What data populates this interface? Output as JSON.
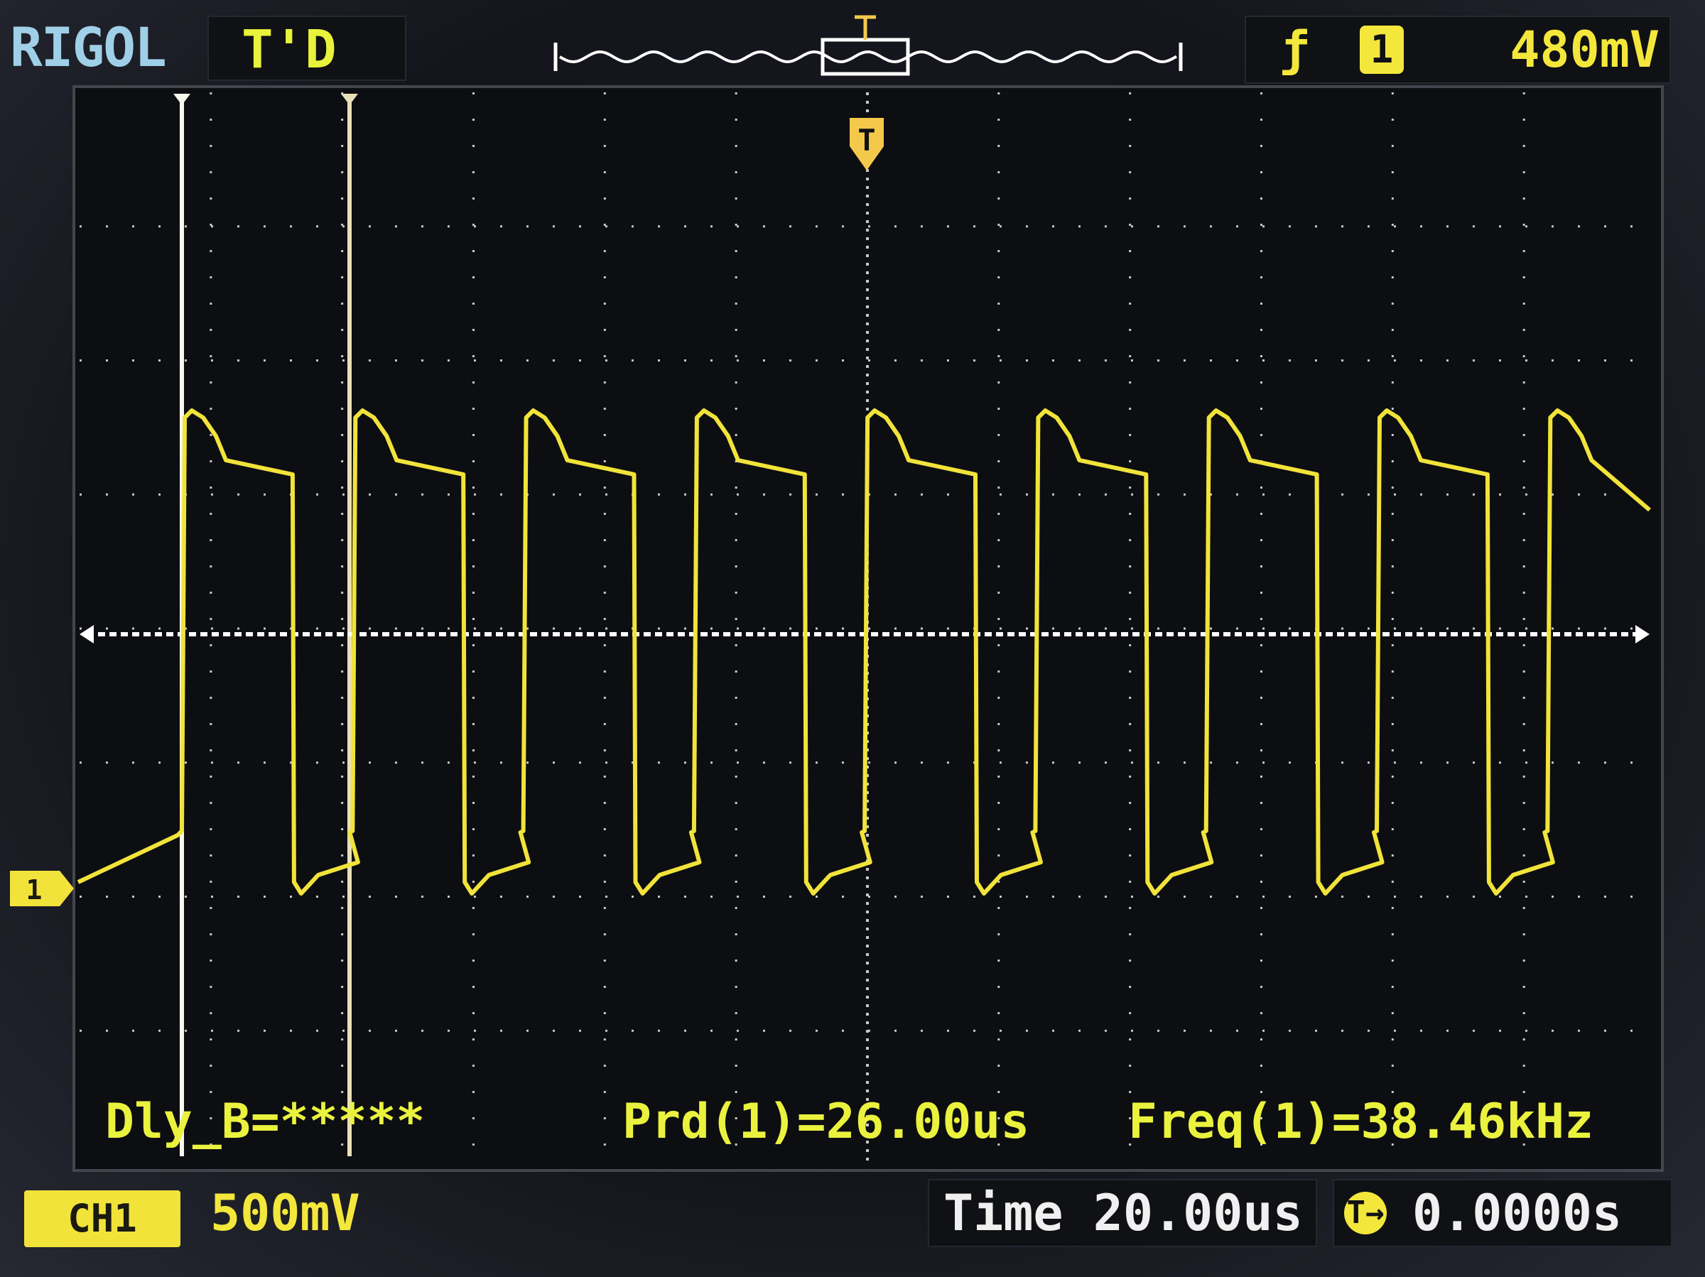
{
  "header": {
    "brand": "RIGOL",
    "run_status": "T'D",
    "trigger": {
      "edge_icon": "rising-edge-icon",
      "edge_glyph": "ƒ",
      "source": "1",
      "level": "480mV"
    }
  },
  "measurements": {
    "delay": "Dly_B=*****",
    "period": "Prd(1)=26.00us",
    "frequency": "Freq(1)=38.46kHz"
  },
  "footer": {
    "channel_badge": "CH1",
    "channel_scale": "500mV",
    "timebase": "Time 20.00us",
    "trigger_offset": "0.0000s",
    "trigger_offset_icon": "trigger-offset-icon",
    "trigger_offset_glyph": "T→"
  },
  "channel_marker": "1",
  "trigger_marker": "T",
  "colors": {
    "trace": "#f1e33a",
    "grid": "#c8c8c8",
    "cursor": "#f6f4ea",
    "trigger_level_line": "#ffffff",
    "brand": "#9fd0e8",
    "background": "#14151c"
  },
  "chart_data": {
    "type": "line",
    "ylabel": "",
    "xlabel": "",
    "series": [
      {
        "name": "CH1",
        "period_us": 26.0,
        "frequency_khz": 38.46,
        "volts_per_div": 0.5,
        "time_per_div_us": 20.0
      }
    ],
    "trigger_level_mv": 480,
    "grid": true
  }
}
